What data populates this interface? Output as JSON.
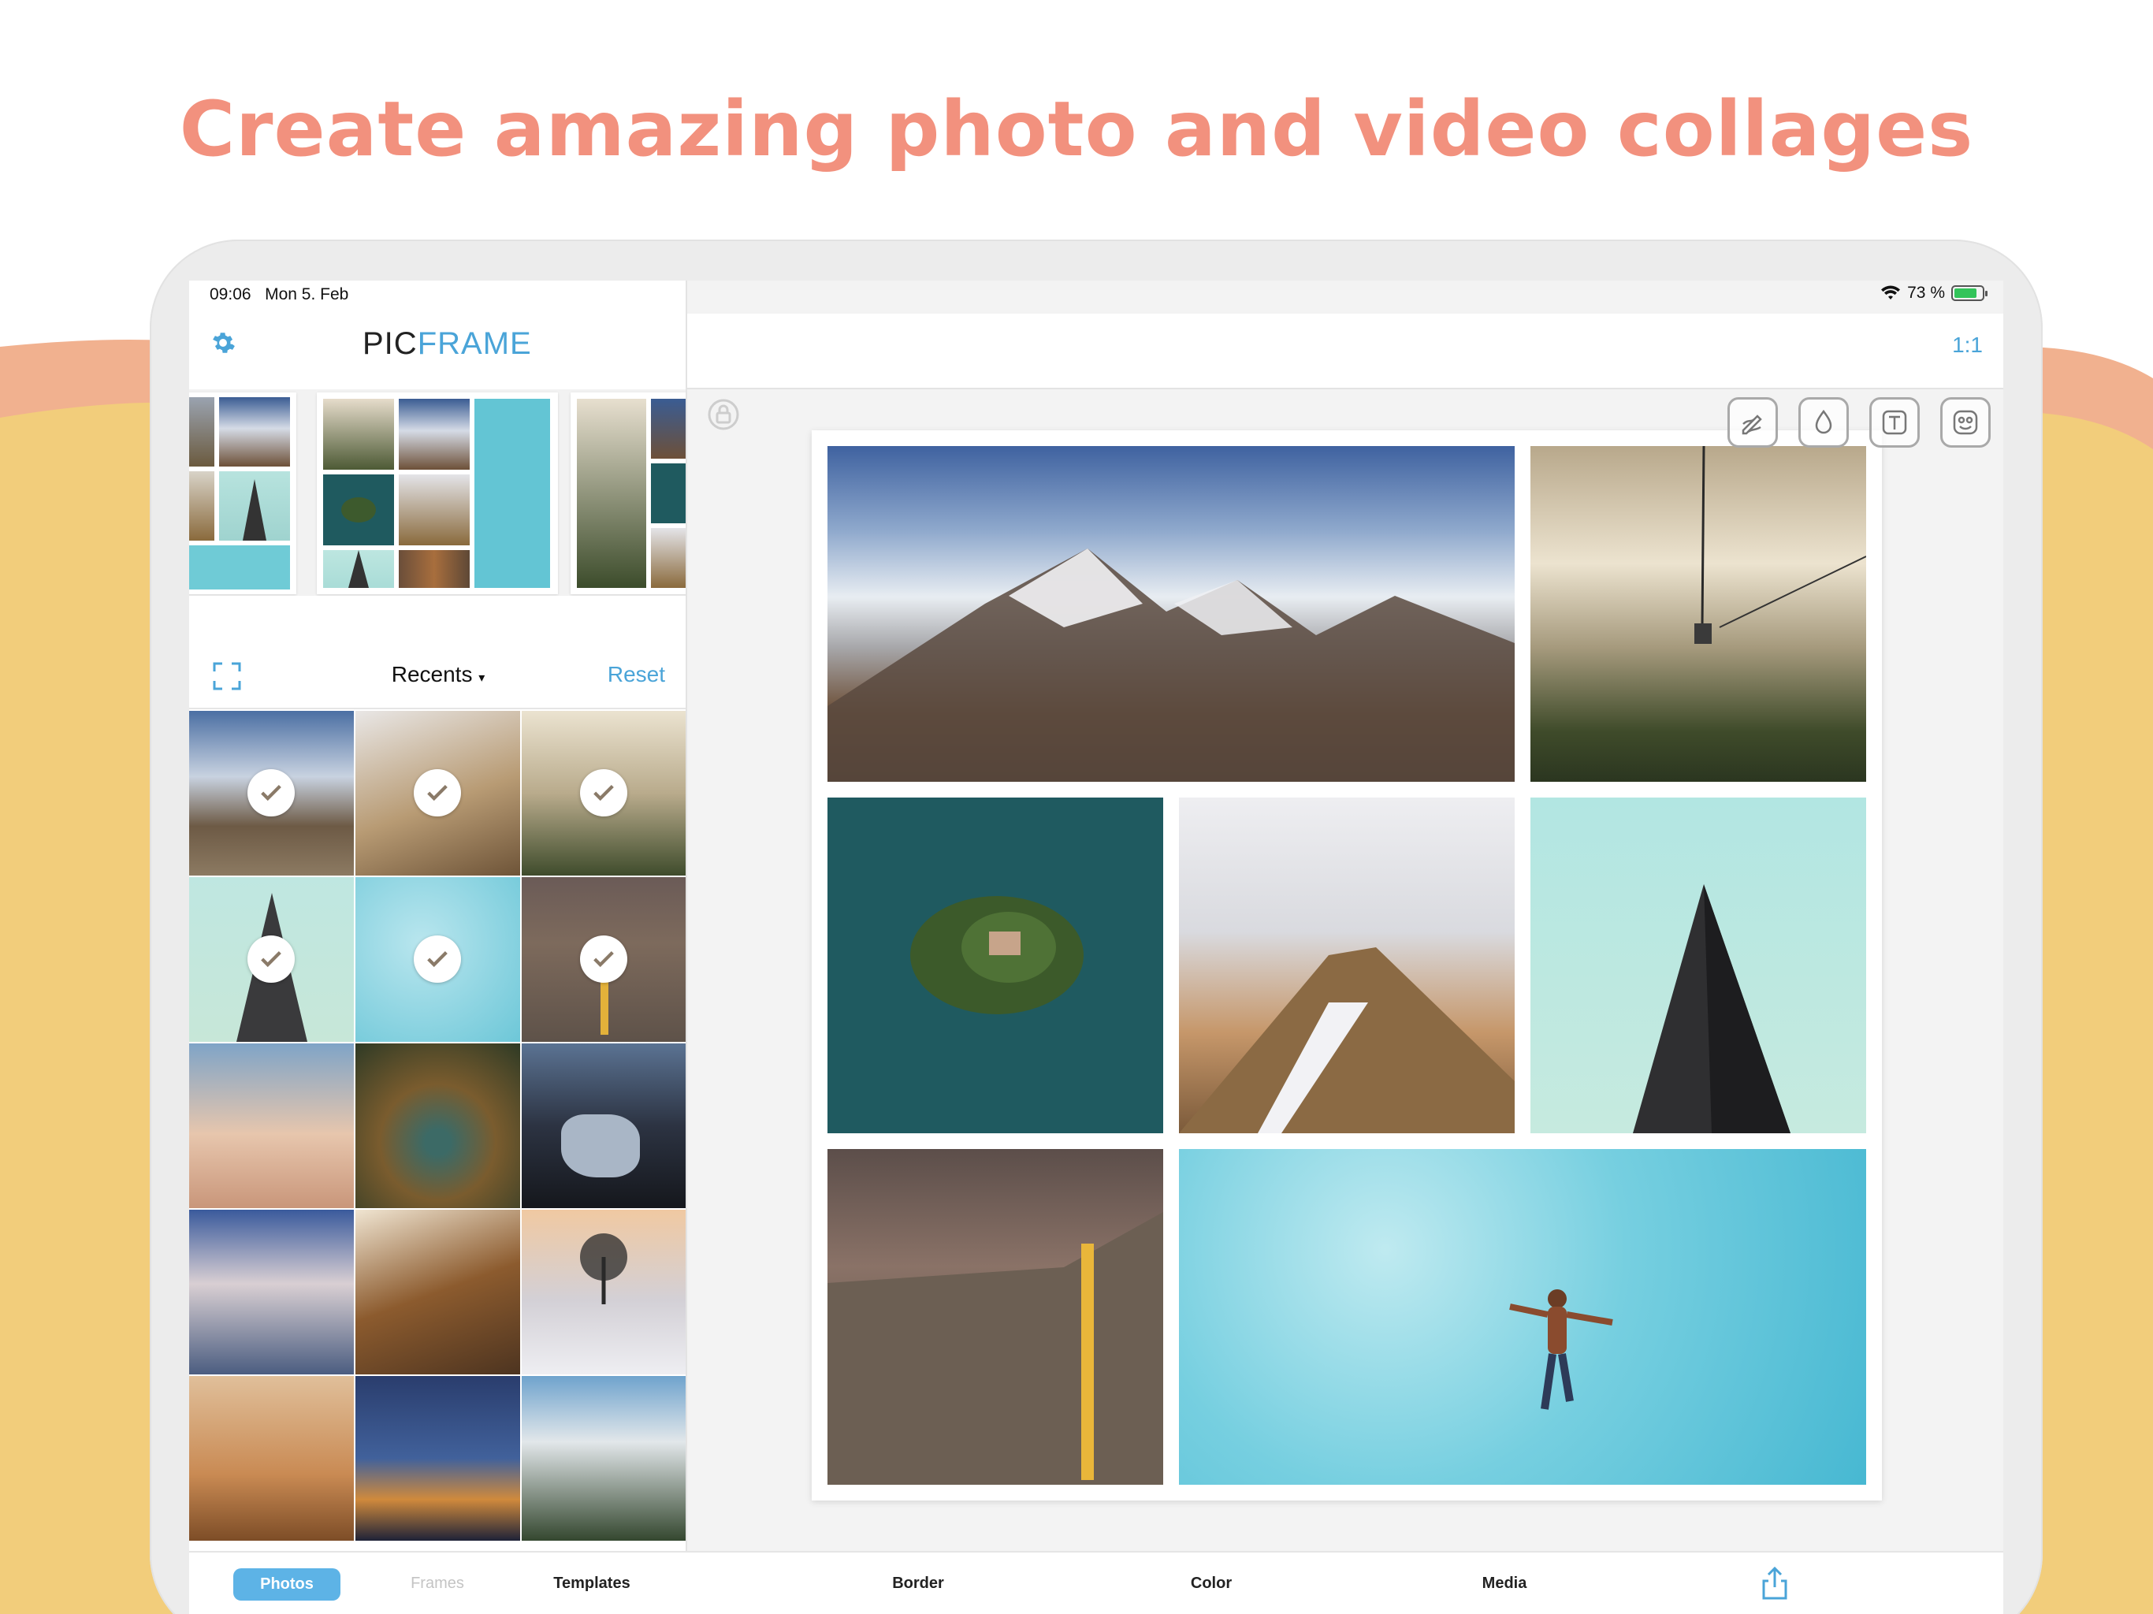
{
  "headline": "Create amazing photo and video collages",
  "status": {
    "time": "09:06",
    "date": "Mon 5. Feb",
    "battery": "73 %"
  },
  "app": {
    "logo_pic": "PIC",
    "logo_frame": "FRAME",
    "aspect_ratio": "1:1"
  },
  "picker": {
    "album": "Recents",
    "reset": "Reset"
  },
  "tabs": {
    "photos": "Photos",
    "frames": "Frames",
    "templates": "Templates",
    "border": "Border",
    "color": "Color",
    "media": "Media"
  },
  "icons": [
    "gear-icon",
    "expand-icon",
    "lock-icon",
    "pen-icon",
    "drop-icon",
    "text-icon",
    "sticker-icon",
    "share-icon",
    "checkmark-icon",
    "wifi-icon",
    "battery-icon"
  ],
  "colors": {
    "accent": "#4aa4d8",
    "headline": "#f2917e",
    "wave_peach": "#f1b18f",
    "wave_yellow": "#f2cd7b"
  }
}
